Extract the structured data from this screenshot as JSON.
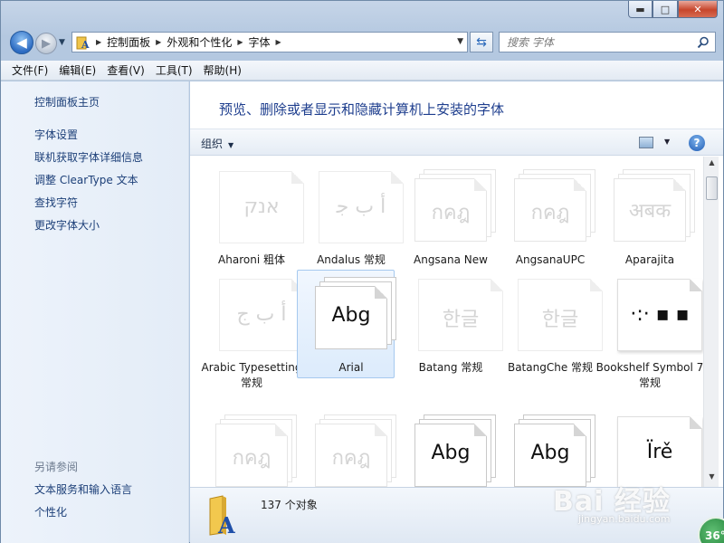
{
  "window": {
    "min_label": "▬",
    "max_label": "□",
    "close_label": "✕"
  },
  "nav": {
    "back_label": "◀",
    "forward_label": "▶"
  },
  "address": {
    "crumbs": [
      "控制面板",
      "外观和个性化",
      "字体"
    ]
  },
  "search": {
    "placeholder": "搜索 字体"
  },
  "menu": [
    "文件(F)",
    "编辑(E)",
    "查看(V)",
    "工具(T)",
    "帮助(H)"
  ],
  "sidebar": {
    "home": "控制面板主页",
    "links": [
      "字体设置",
      "联机获取字体详细信息",
      "调整 ClearType 文本",
      "查找字符",
      "更改字体大小"
    ],
    "see_also_heading": "另请参阅",
    "see_also": [
      "文本服务和输入语言",
      "个性化"
    ]
  },
  "main": {
    "title": "预览、删除或者显示和隐藏计算机上安装的字体",
    "organize_label": "组织",
    "help_label": "?"
  },
  "fonts": [
    {
      "name": "Aharoni 粗体",
      "sample": "אנק",
      "style": "single",
      "faded": true
    },
    {
      "name": "Andalus 常规",
      "sample": "أ ب ﺟ",
      "style": "single",
      "faded": true
    },
    {
      "name": "Angsana New",
      "sample": "กคฎ",
      "style": "stack",
      "faded": true
    },
    {
      "name": "AngsanaUPC",
      "sample": "กคฎ",
      "style": "stack",
      "faded": true
    },
    {
      "name": "Aparajita",
      "sample": "अबक",
      "style": "stack",
      "faded": true
    },
    {
      "name": "Arabic Typesetting 常规",
      "sample": "أ ب ج",
      "style": "single",
      "faded": true
    },
    {
      "name": "Arial",
      "sample": "Abg",
      "style": "stack",
      "faded": false,
      "selected": true
    },
    {
      "name": "Batang 常规",
      "sample": "한글",
      "style": "single",
      "faded": true
    },
    {
      "name": "BatangChe 常规",
      "sample": "한글",
      "style": "single",
      "faded": true
    },
    {
      "name": "Bookshelf Symbol 7 常规",
      "sample": "·:· ▪ ▪",
      "style": "single",
      "faded": false
    },
    {
      "name": "",
      "sample": "กคฎ",
      "style": "stack",
      "faded": true
    },
    {
      "name": "",
      "sample": "กคฎ",
      "style": "stack",
      "faded": true
    },
    {
      "name": "",
      "sample": "Abg",
      "style": "stack",
      "faded": false
    },
    {
      "name": "",
      "sample": "Abg",
      "style": "stack",
      "faded": false
    },
    {
      "name": "",
      "sample": "Ïrě",
      "style": "single",
      "faded": false
    }
  ],
  "details": {
    "count": "137 个对象"
  },
  "watermark": {
    "logo": "Bai 经验",
    "url": "jingyan.baidu.com",
    "badge": "36°"
  },
  "colors": {
    "link": "#1c3f78",
    "title": "#1e3e8e",
    "accent": "#2c6bc2"
  }
}
